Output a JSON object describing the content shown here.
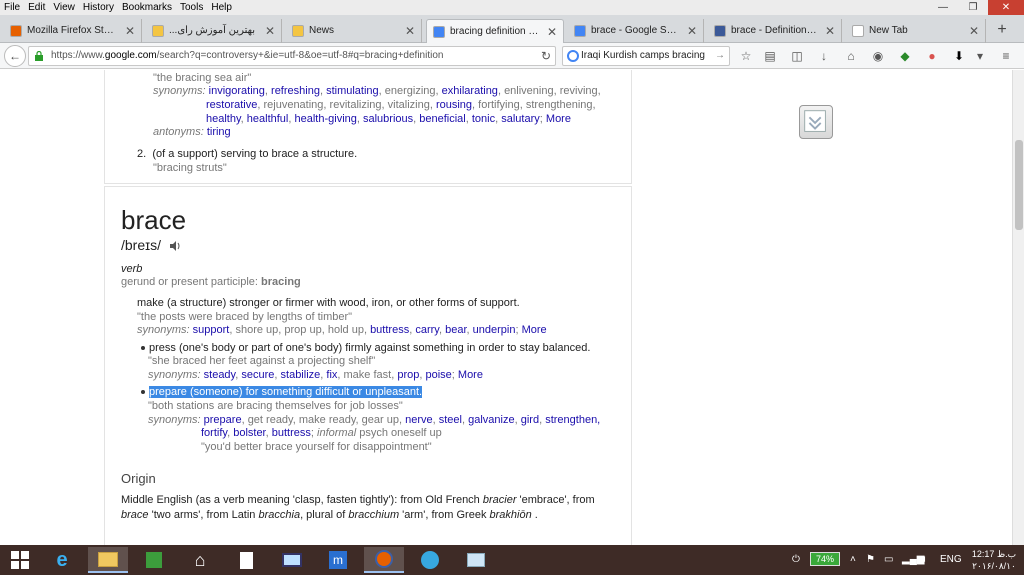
{
  "menu": [
    "File",
    "Edit",
    "View",
    "History",
    "Bookmarks",
    "Tools",
    "Help"
  ],
  "tabs": [
    {
      "label": "Mozilla Firefox Start P...",
      "color": "#e66000",
      "icon": "firefox-icon"
    },
    {
      "label": "...بهترین آموزش رای",
      "color": "#f4c542",
      "icon": "cloud-icon"
    },
    {
      "label": "News",
      "color": "#f4c542",
      "icon": "cloud-icon"
    },
    {
      "label": "bracing definition - G...",
      "color": "#4285f4",
      "icon": "google-icon",
      "active": true
    },
    {
      "label": "brace - Google Search",
      "color": "#4285f4",
      "icon": "google-icon"
    },
    {
      "label": "brace - Definition fro...",
      "color": "#3b5998",
      "icon": "dictionary-icon"
    },
    {
      "label": "New Tab",
      "color": "#ffffff",
      "icon": "blank-icon"
    }
  ],
  "nav": {
    "url_prefix": "https://www.",
    "url_domain": "google.com",
    "url_rest": "/search?q=controversy+&ie=utf-8&oe=utf-8#q=bracing+definition",
    "search_value": "Iraqi Kurdish camps bracing"
  },
  "top_card": {
    "example1": "\"the bracing sea air\"",
    "syn_label": "synonyms:",
    "syn_row1": [
      "invigorating",
      "refreshing",
      "stimulating",
      "energizing",
      "exhilarating",
      "enlivening",
      "reviving,"
    ],
    "syn_row1_gray": [
      false,
      false,
      false,
      true,
      false,
      true,
      true
    ],
    "syn_row2": [
      "restorative",
      "rejuvenating",
      "revitalizing",
      "vitalizing",
      "rousing",
      "fortifying",
      "strengthening,"
    ],
    "syn_row2_gray": [
      false,
      true,
      true,
      true,
      false,
      true,
      true
    ],
    "syn_row3": [
      "healthy",
      "healthful",
      "health-giving",
      "salubrious",
      "beneficial",
      "tonic",
      "salutary"
    ],
    "more": "More",
    "ant_label": "antonyms:",
    "antonym": "tiring",
    "sense2_num": "2.",
    "sense2_def": "(of a support) serving to brace a structure.",
    "sense2_ex": "\"bracing struts\""
  },
  "entry": {
    "word": "brace",
    "pronunciation": "/breɪs/",
    "pos": "verb",
    "gerund_label": "gerund or present participle:",
    "gerund": "bracing",
    "def1": "make (a structure) stronger or firmer with wood, iron, or other forms of support.",
    "ex1": "\"the posts were braced by lengths of timber\"",
    "syn1": [
      "support",
      "shore up",
      "prop up",
      "hold up",
      "buttress",
      "carry",
      "bear",
      "underpin"
    ],
    "syn1_gray": [
      false,
      true,
      true,
      true,
      false,
      false,
      false,
      false
    ],
    "def2": "press (one's body or part of one's body) firmly against something in order to stay balanced.",
    "ex2": "\"she braced her feet against a projecting shelf\"",
    "syn2": [
      "steady",
      "secure",
      "stabilize",
      "fix",
      "make fast",
      "prop",
      "poise"
    ],
    "syn2_gray": [
      false,
      false,
      false,
      false,
      true,
      false,
      false
    ],
    "def3": "prepare (someone) for something difficult or unpleasant.",
    "ex3": "\"both stations are bracing themselves for job losses\"",
    "syn3_row1": [
      "prepare",
      "get ready",
      "make ready",
      "gear up",
      "nerve",
      "steel",
      "galvanize",
      "gird",
      "strengthen,"
    ],
    "syn3_row1_gray": [
      false,
      true,
      true,
      true,
      false,
      false,
      false,
      false,
      false
    ],
    "syn3_row2": [
      "fortify",
      "bolster",
      "buttress"
    ],
    "informal_label": "informal",
    "informal_syn": "psych oneself up",
    "ex3b": "\"you'd better brace yourself for disappointment\"",
    "origin_heading": "Origin",
    "origin_text_parts": [
      "Middle English (as a verb meaning 'clasp, fasten tightly'): from Old French ",
      "bracier",
      " 'embrace', from ",
      "brace",
      " 'two arms', from Latin ",
      "bracchia",
      ", plural of ",
      "bracchium",
      " 'arm', from Greek ",
      "brakhiōn",
      " ."
    ]
  },
  "taskbar": {
    "battery": "74%",
    "lang": "ENG",
    "time": "12:17 ب.ظ",
    "date": "۲۰۱۶/۰۸/۱۰"
  },
  "colors": {
    "link": "#1a0dab",
    "gray": "#777777",
    "highlight": "#3b89e4",
    "taskbar": "#3e2b26"
  }
}
